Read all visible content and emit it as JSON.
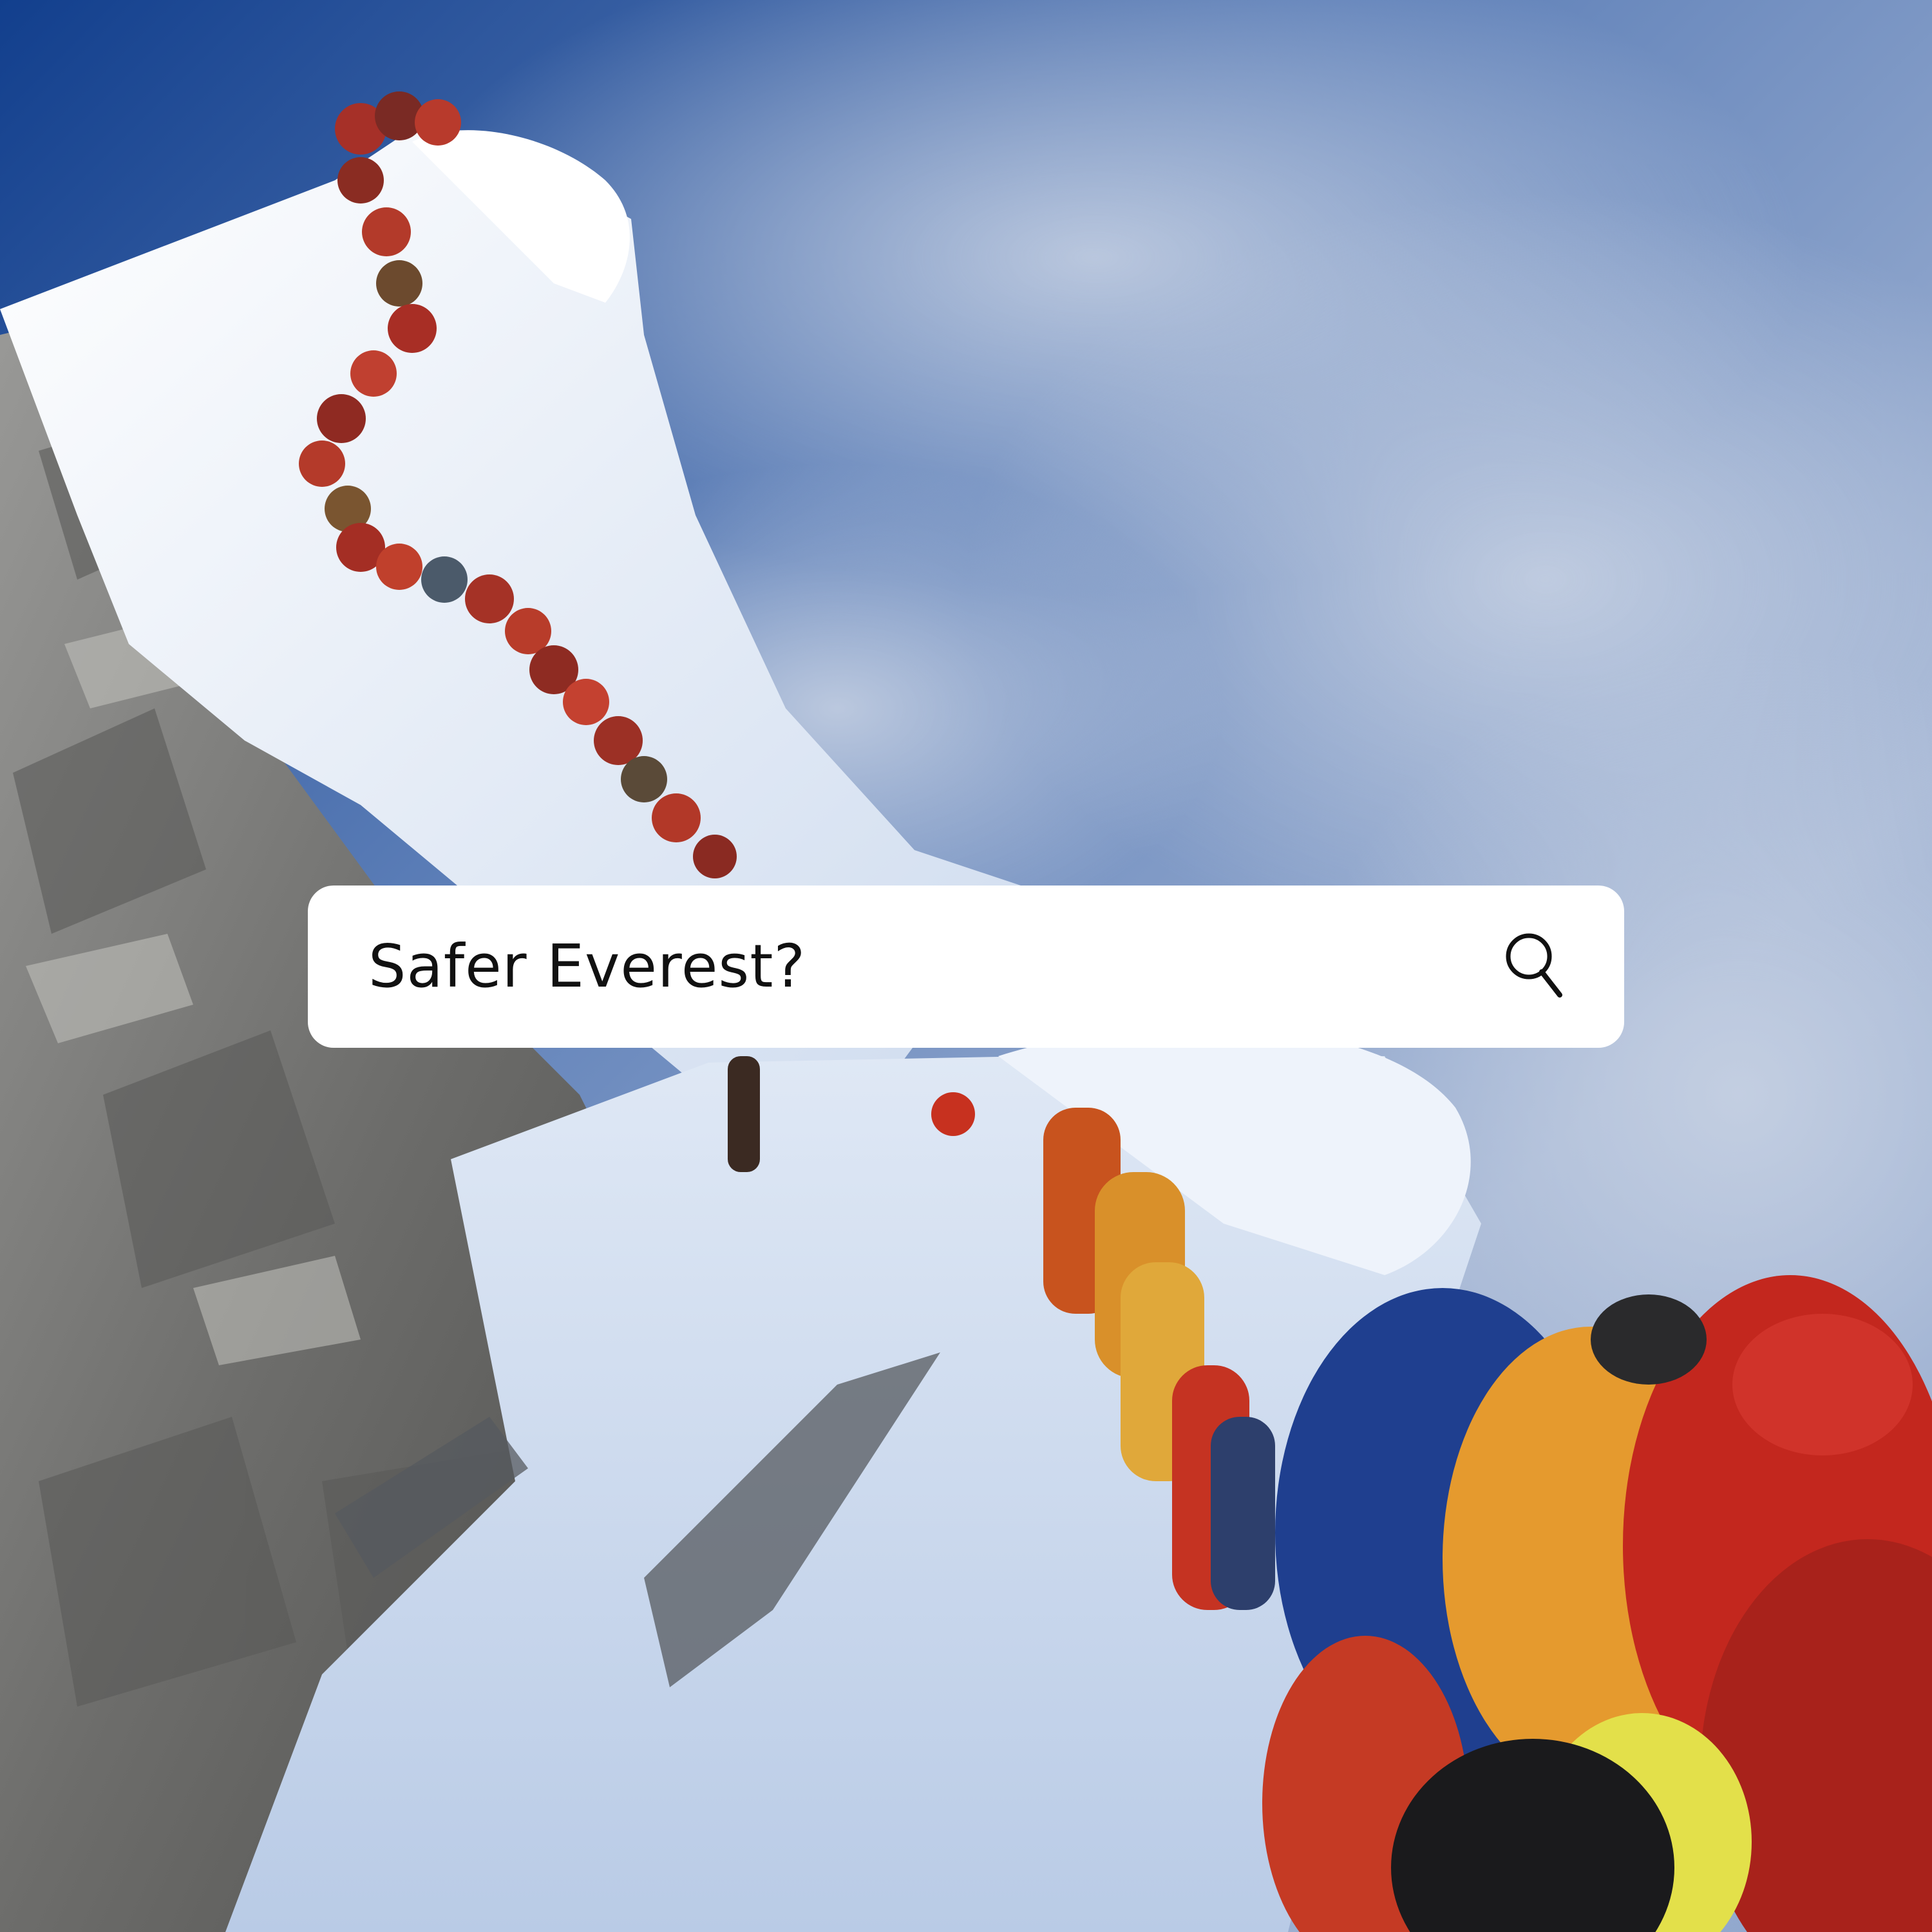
{
  "search": {
    "query": "Safer Everest?",
    "icon": "search-icon"
  },
  "photo": {
    "subject": "everest-summit-ridge-climbers",
    "sky_color": "#1f4d9a",
    "cloud_color": "#a9bbd8",
    "snow_color": "#eef3fb",
    "rock_color": "#8c8c8a"
  }
}
